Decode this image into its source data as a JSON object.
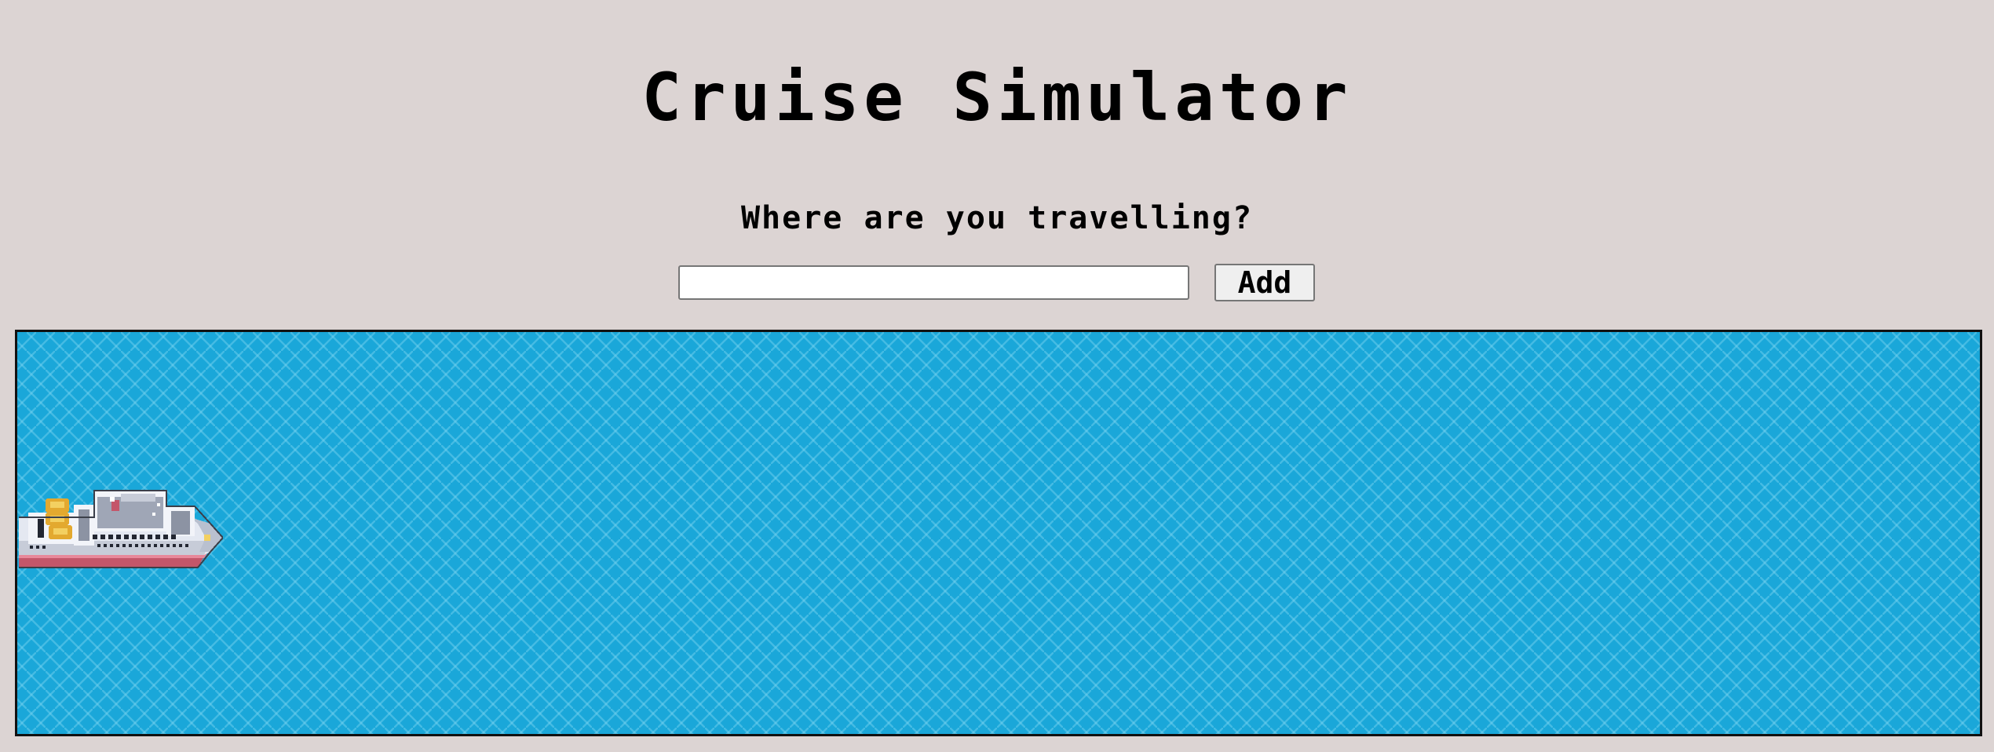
{
  "header": {
    "title": "Cruise Simulator"
  },
  "form": {
    "prompt": "Where are you travelling?",
    "destination_value": "",
    "destination_placeholder": "",
    "add_label": "Add"
  },
  "scene": {
    "ocean_color": "#1aa7d9",
    "ship_icon": "cruise-ship-icon"
  }
}
